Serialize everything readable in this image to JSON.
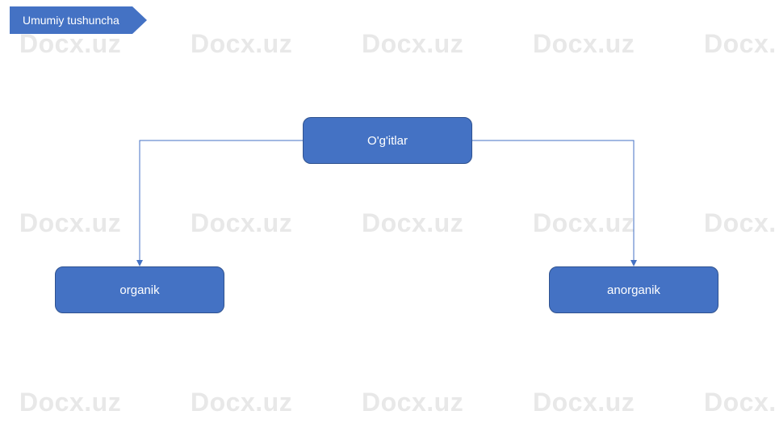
{
  "ribbon": {
    "label": "Umumiy tushuncha"
  },
  "diagram": {
    "root": {
      "label": "O'g'itlar"
    },
    "children": [
      {
        "label": "organik"
      },
      {
        "label": "anorganik"
      }
    ]
  },
  "watermark": {
    "text": "Docx.uz"
  },
  "colors": {
    "node_fill": "#4472c4",
    "node_stroke": "#2f528f",
    "watermark": "#e8e8e8"
  }
}
